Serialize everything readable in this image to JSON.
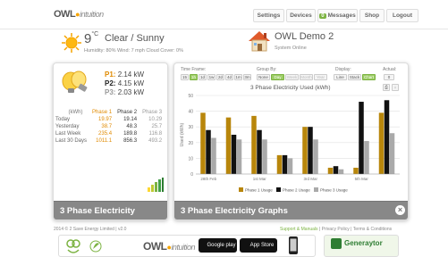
{
  "header": {
    "logo_main": "OWL",
    "logo_sub": "intuition",
    "nav": [
      {
        "label": "Settings"
      },
      {
        "label": "Devices"
      },
      {
        "label": "Messages",
        "count": "0"
      },
      {
        "label": "Shop"
      },
      {
        "label": "Logout"
      }
    ]
  },
  "weather": {
    "temp": "9",
    "unit": "°C",
    "condition": "Clear / Sunny",
    "details": "Humidity: 80%   Wind: 7 mph   Cloud Cover: 0%"
  },
  "system": {
    "name": "OWL Demo 2",
    "status": "System Online"
  },
  "electricity": {
    "footer_title": "3 Phase Electricity",
    "phases": [
      {
        "label": "P1:",
        "value": "2.14 kW"
      },
      {
        "label": "P2:",
        "value": "4.15 kW"
      },
      {
        "label": "P3:",
        "value": "2.03 kW"
      }
    ],
    "table": {
      "headers": [
        "(kWh)",
        "Phase 1",
        "Phase 2",
        "Phase 3"
      ],
      "rows": [
        [
          "Today",
          "19.97",
          "19.14",
          "10.29"
        ],
        [
          "Yesterday",
          "38.7",
          "48.3",
          "25.7"
        ],
        [
          "Last Week",
          "235.4",
          "189.8",
          "116.8"
        ],
        [
          "Last 30 Days",
          "1011.1",
          "856.3",
          "493.2"
        ]
      ]
    }
  },
  "graphs": {
    "footer_title": "3 Phase Electricity Graphs",
    "controls": {
      "time_frame_label": "Time Frame:",
      "time_frames": [
        "15",
        "1h",
        "1d",
        "1w",
        "2d",
        "4d",
        "1m",
        "3m"
      ],
      "group_by_label": "Group By:",
      "group_by": [
        "None",
        "Day",
        "Week",
        "Month",
        "Year"
      ],
      "display_label": "Display:",
      "display": [
        "Line",
        "Stack",
        "Chart"
      ],
      "actual_label": "Actual:",
      "actual_value": "0"
    }
  },
  "chart_data": {
    "type": "bar",
    "title": "3 Phase Electricity Used (kWh)",
    "ylabel": "Used (kWh)",
    "ylim": [
      0,
      50
    ],
    "yticks": [
      0,
      10,
      20,
      30,
      40,
      50
    ],
    "categories": [
      "28th Feb",
      "",
      "1st Mar",
      "",
      "3rd Mar",
      "",
      "5th Mar",
      ""
    ],
    "series": [
      {
        "name": "Phase 1 Usage",
        "color": "#b8860b",
        "values": [
          39,
          36,
          37,
          12,
          30,
          4,
          4,
          39
        ]
      },
      {
        "name": "Phase 2 Usage",
        "color": "#111111",
        "values": [
          28,
          25,
          28,
          12,
          30,
          5,
          46,
          47
        ]
      },
      {
        "name": "Phase 3 Usage",
        "color": "#aaaaaa",
        "values": [
          23,
          22,
          22,
          10,
          22,
          3,
          21,
          26
        ]
      }
    ]
  },
  "footer": {
    "copyright": "2014 © 2 Save Energy Limited  |  v2.0",
    "links": [
      "Support & Manuals",
      "Privacy Policy",
      "Terms & Conditions"
    ],
    "google_play": "Google play",
    "app_store": "App Store",
    "generaytor": "Generaytor"
  }
}
